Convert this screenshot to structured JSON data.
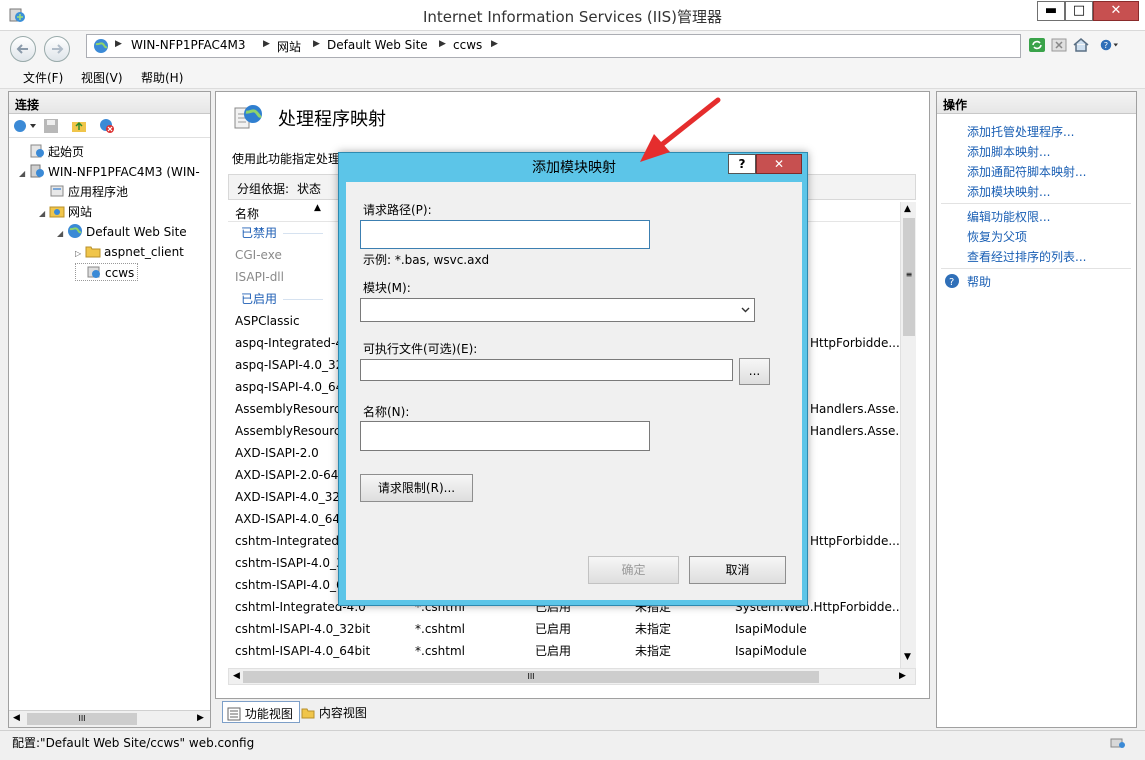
{
  "window": {
    "title": "Internet Information Services (IIS)管理器",
    "min": "▬",
    "max": "□",
    "close": "✕"
  },
  "address": {
    "crumbs": [
      "WIN-NFP1PFAC4M3",
      "网站",
      "Default Web Site",
      "ccws"
    ]
  },
  "menu": [
    "文件(F)",
    "视图(V)",
    "帮助(H)"
  ],
  "left": {
    "header": "连接",
    "tree": [
      {
        "label": "起始页",
        "icon": "start-page-icon"
      },
      {
        "label": "WIN-NFP1PFAC4M3 (WIN-",
        "icon": "server-icon"
      },
      {
        "label": "应用程序池",
        "icon": "app-pool-icon"
      },
      {
        "label": "网站",
        "icon": "sites-folder-icon"
      },
      {
        "label": "Default Web Site",
        "icon": "globe-icon"
      },
      {
        "label": "aspnet_client",
        "icon": "folder-icon"
      },
      {
        "label": "ccws",
        "icon": "app-icon"
      }
    ],
    "scroll_mark": "III"
  },
  "center": {
    "title": "处理程序映射",
    "description": "使用此功能指定处理",
    "group_label": "分组依据:",
    "group_value": "状态",
    "column_name": "名称",
    "groups": {
      "disabled": "已禁用",
      "enabled": "已启用"
    },
    "disabled_rows": [
      "CGI-exe",
      "ISAPI-dll"
    ],
    "enabled_rows": [
      {
        "name": "ASPClassic",
        "tail": ""
      },
      {
        "name": "aspq-Integrated-4",
        "tail": "HttpForbidde..."
      },
      {
        "name": "aspq-ISAPI-4.0_32",
        "tail": ""
      },
      {
        "name": "aspq-ISAPI-4.0_64",
        "tail": ""
      },
      {
        "name": "AssemblyResourc",
        "tail": "Handlers.Asse..."
      },
      {
        "name": "AssemblyResourc",
        "tail": "Handlers.Asse..."
      },
      {
        "name": "AXD-ISAPI-2.0",
        "tail": ""
      },
      {
        "name": "AXD-ISAPI-2.0-64",
        "tail": ""
      },
      {
        "name": "AXD-ISAPI-4.0_32",
        "tail": ""
      },
      {
        "name": "AXD-ISAPI-4.0_64",
        "tail": ""
      },
      {
        "name": "cshtm-Integrated-",
        "tail": "HttpForbidde..."
      },
      {
        "name": "cshtm-ISAPI-4.0_3",
        "tail": ""
      },
      {
        "name": "cshtm-ISAPI-4.0_6",
        "tail": ""
      }
    ],
    "full_rows": [
      {
        "name": "cshtml-Integrated-4.0",
        "path": "*.cshtml",
        "state": "已启用",
        "type": "未指定",
        "handler": "System.Web.HttpForbidde..."
      },
      {
        "name": "cshtml-ISAPI-4.0_32bit",
        "path": "*.cshtml",
        "state": "已启用",
        "type": "未指定",
        "handler": "IsapiModule"
      },
      {
        "name": "cshtml-ISAPI-4.0_64bit",
        "path": "*.cshtml",
        "state": "已启用",
        "type": "未指定",
        "handler": "IsapiModule"
      }
    ],
    "scroll_mark": "III",
    "tabs": [
      "功能视图",
      "内容视图"
    ]
  },
  "right": {
    "header": "操作",
    "actions": [
      "添加托管处理程序...",
      "添加脚本映射...",
      "添加通配符脚本映射...",
      "添加模块映射..."
    ],
    "actions2": [
      "编辑功能权限...",
      "恢复为父项",
      "查看经过排序的列表..."
    ],
    "help": "帮助"
  },
  "status": {
    "text": "配置:\"Default Web Site/ccws\" web.config"
  },
  "dialog": {
    "title": "添加模块映射",
    "help_btn": "?",
    "close_btn": "✕",
    "request_path_label": "请求路径(P):",
    "request_path_value": "",
    "example": "示例: *.bas, wsvc.axd",
    "module_label": "模块(M):",
    "module_value": "",
    "exec_label": "可执行文件(可选)(E):",
    "exec_value": "",
    "browse_btn": "...",
    "name_label": "名称(N):",
    "name_value": "",
    "restrictions_btn": "请求限制(R)...",
    "ok_btn": "确定",
    "cancel_btn": "取消"
  },
  "colors": {
    "dialog_frame": "#5cc5e8",
    "link": "#1a5fb4",
    "arrow": "#e52d2d"
  }
}
